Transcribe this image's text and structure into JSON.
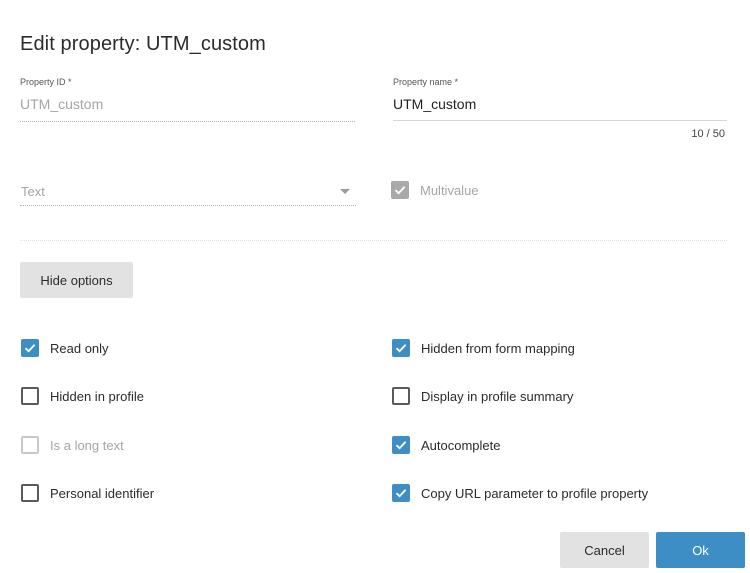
{
  "dialog": {
    "title": "Edit property: UTM_custom"
  },
  "property_id": {
    "label": "Property ID *",
    "value": "UTM_custom"
  },
  "property_name": {
    "label": "Property name *",
    "value": "UTM_custom",
    "counter": "10 / 50"
  },
  "type_select": {
    "value": "Text",
    "icon": "caret-down-icon"
  },
  "multivalue": {
    "label": "Multivalue",
    "checked": true,
    "disabled": true
  },
  "options_button": {
    "label": "Hide options"
  },
  "options": {
    "read_only": {
      "label": "Read only",
      "checked": true,
      "disabled": false
    },
    "hidden_from_form_mapping": {
      "label": "Hidden from form mapping",
      "checked": true,
      "disabled": false
    },
    "hidden_in_profile": {
      "label": "Hidden in profile",
      "checked": false,
      "disabled": false
    },
    "display_in_profile_summary": {
      "label": "Display in profile summary",
      "checked": false,
      "disabled": false
    },
    "is_long_text": {
      "label": "Is a long text",
      "checked": false,
      "disabled": true
    },
    "autocomplete": {
      "label": "Autocomplete",
      "checked": true,
      "disabled": false
    },
    "personal_identifier": {
      "label": "Personal identifier",
      "checked": false,
      "disabled": false
    },
    "copy_url_parameter": {
      "label": "Copy URL parameter to profile property",
      "checked": true,
      "disabled": false
    }
  },
  "footer": {
    "cancel_label": "Cancel",
    "ok_label": "Ok"
  },
  "colors": {
    "accent": "#3c8ec4",
    "button_gray": "#e2e2e2",
    "disabled_check": "#a9a9a9"
  }
}
